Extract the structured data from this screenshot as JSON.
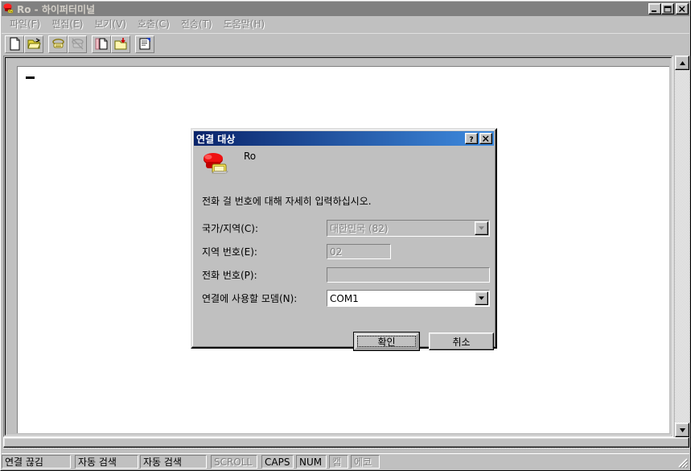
{
  "window": {
    "title": "Ro - 하이퍼터미널",
    "icon": "hyperterminal-phone-icon",
    "controls": [
      {
        "name": "minimize-button",
        "glyph": "minimize-icon"
      },
      {
        "name": "maximize-button",
        "glyph": "maximize-icon"
      },
      {
        "name": "close-button",
        "glyph": "close-icon"
      }
    ]
  },
  "menu": {
    "items": [
      {
        "label": "파일(F)",
        "mnemonic": "F",
        "name": "menu-file"
      },
      {
        "label": "편집(E)",
        "mnemonic": "E",
        "name": "menu-edit"
      },
      {
        "label": "보기(V)",
        "mnemonic": "V",
        "name": "menu-view"
      },
      {
        "label": "호출(C)",
        "mnemonic": "C",
        "name": "menu-call"
      },
      {
        "label": "전송(T)",
        "mnemonic": "T",
        "name": "menu-transfer"
      },
      {
        "label": "도움말(H)",
        "mnemonic": "H",
        "name": "menu-help"
      }
    ]
  },
  "toolbar": {
    "buttons": [
      {
        "name": "new-connection-button",
        "icon": "new-document-icon",
        "enabled": true
      },
      {
        "name": "open-button",
        "icon": "open-folder-icon",
        "enabled": true
      },
      {
        "name": "call-button",
        "icon": "phone-dial-icon",
        "enabled": true
      },
      {
        "name": "disconnect-button",
        "icon": "phone-hangup-icon",
        "enabled": false
      },
      {
        "name": "send-file-button",
        "icon": "send-document-icon",
        "enabled": true
      },
      {
        "name": "receive-file-button",
        "icon": "receive-folder-icon",
        "enabled": true
      },
      {
        "name": "properties-button",
        "icon": "properties-icon",
        "enabled": true
      }
    ]
  },
  "terminal": {
    "content": "",
    "cursor": "_"
  },
  "statusbar": {
    "panels": [
      {
        "text": "연결 끊김",
        "name": "status-connection",
        "dim": false,
        "width": 86
      },
      {
        "text": "자동 검색",
        "name": "status-autodetect-1",
        "dim": false,
        "width": 79
      },
      {
        "text": "자동 검색",
        "name": "status-autodetect-2",
        "dim": false,
        "width": 83
      },
      {
        "text": "SCROLL",
        "name": "status-scroll",
        "dim": true,
        "width": 58
      },
      {
        "text": "CAPS",
        "name": "status-caps",
        "dim": false,
        "width": 40
      },
      {
        "text": "NUM",
        "name": "status-num",
        "dim": false,
        "width": 38
      },
      {
        "text": "캡",
        "name": "status-capture",
        "dim": true,
        "width": 24
      },
      {
        "text": "에코",
        "name": "status-echo",
        "dim": true,
        "width": 36
      }
    ]
  },
  "dialog": {
    "title": "연결 대상",
    "icon": "red-telephone-icon",
    "connection_name": "Ro",
    "instruction": "전화 걸 번호에 대해 자세히 입력하십시오.",
    "fields": [
      {
        "label": "국가/지역(C):",
        "mnemonic": "C",
        "value": "대한민국 (82)",
        "placeholder": "",
        "type": "combobox",
        "enabled": false,
        "name": "country-region-combobox"
      },
      {
        "label": "지역 번호(E):",
        "mnemonic": "E",
        "value": "02",
        "placeholder": "",
        "type": "text",
        "enabled": false,
        "name": "area-code-input"
      },
      {
        "label": "전화 번호(P):",
        "mnemonic": "P",
        "value": "",
        "placeholder": "",
        "type": "text",
        "enabled": false,
        "name": "phone-number-input"
      },
      {
        "label": "연결에 사용할 모뎀(N):",
        "mnemonic": "N",
        "value": "COM1",
        "placeholder": "",
        "type": "combobox",
        "enabled": true,
        "name": "modem-combobox"
      }
    ],
    "buttons": [
      {
        "label": "확인",
        "name": "ok-button",
        "default": true
      },
      {
        "label": "취소",
        "name": "cancel-button",
        "default": false
      }
    ],
    "titlebar_buttons": [
      {
        "name": "help-button",
        "glyph": "question-mark-icon"
      },
      {
        "name": "close-button",
        "glyph": "close-icon"
      }
    ]
  },
  "colors": {
    "face": "#c0c0c0",
    "inactive_caption": "#808080",
    "active_caption_start": "#0a246a",
    "active_caption_end": "#3f8ce0",
    "disabled_text": "#808080"
  }
}
